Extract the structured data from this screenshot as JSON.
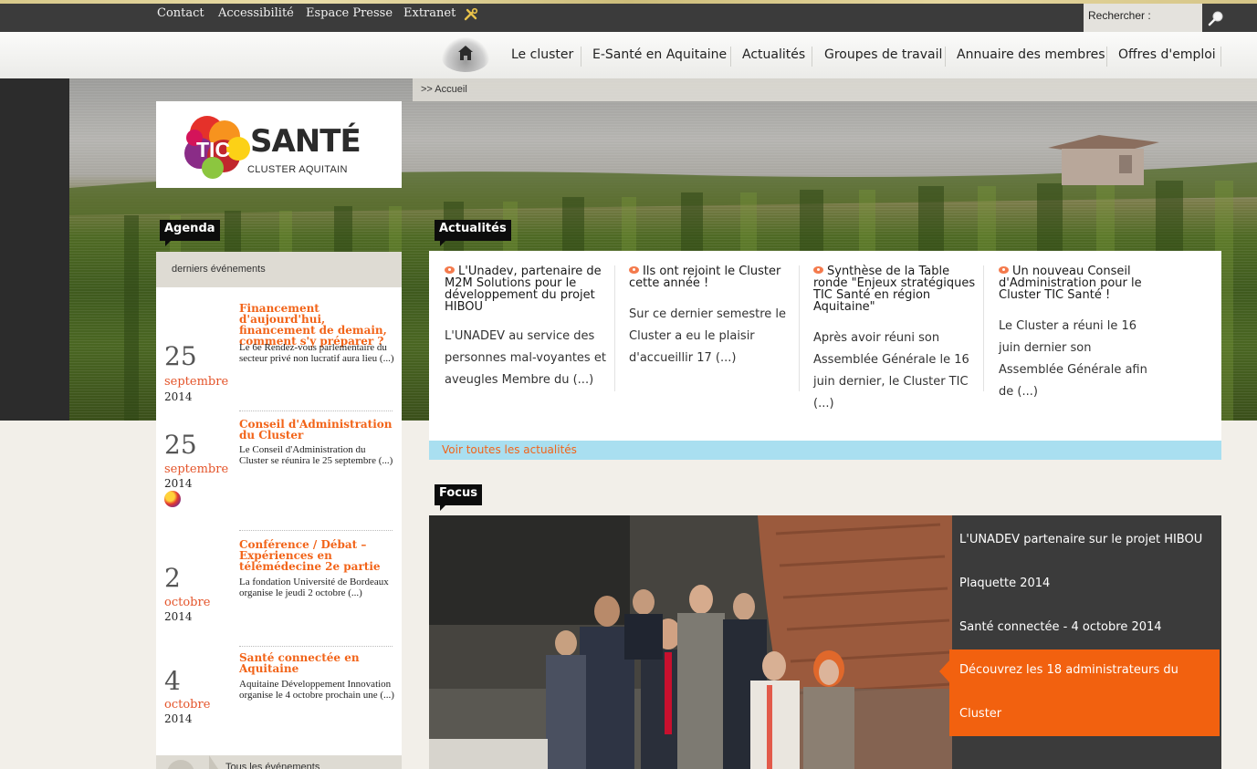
{
  "topbar": {
    "links": [
      "Contact",
      "Accessibilité",
      "Espace Presse",
      "Extranet"
    ],
    "search_label": "Rechercher :",
    "search_value": ""
  },
  "nav": {
    "items": [
      "Le cluster",
      "E-Santé en Aquitaine",
      "Actualités",
      "Groupes de travail",
      "Annuaire des membres",
      "Offres d'emploi"
    ]
  },
  "breadcrumb": ">> Accueil",
  "logo": {
    "mark": "TIC",
    "name": "SANTÉ",
    "subtitle": "CLUSTER AQUITAIN"
  },
  "agenda": {
    "tag": "Agenda",
    "header": "derniers événements",
    "events": [
      {
        "day": "25",
        "month": "septembre",
        "year": "2014",
        "title": "Financement d'aujourd'hui, financement de demain, comment s'y préparer ?",
        "desc": "Le 6e Rendez-vous parlementaire du secteur privé non lucratif aura lieu (...)"
      },
      {
        "day": "25",
        "month": "septembre",
        "year": "2014",
        "title": "Conseil d'Administration du Cluster",
        "desc": "Le Conseil d'Administration du Cluster se réunira le 25 septembre (...)"
      },
      {
        "day": "2",
        "month": "octobre",
        "year": "2014",
        "title": "Conférence / Débat – Expériences en télémédecine 2e partie",
        "desc": "La fondation Université de Bordeaux organise le jeudi 2 octobre (...)"
      },
      {
        "day": "4",
        "month": "octobre",
        "year": "2014",
        "title": "Santé connectée en Aquitaine",
        "desc": "Aquitaine Développement Innovation organise le 4 octobre prochain une (...)"
      }
    ],
    "all_events": "Tous les événements"
  },
  "news": {
    "tag": "Actualités",
    "items": [
      {
        "title": "L'Unadev, partenaire de M2M Solutions pour le développement du projet HIBOU",
        "body": "L'UNADEV au service des personnes mal-voyantes et aveugles Membre du (...)"
      },
      {
        "title": "Ils ont rejoint le Cluster cette année !",
        "body": "Sur ce dernier semestre le Cluster a eu le plaisir d'accueillir 17 (...)"
      },
      {
        "title": "Synthèse de la Table ronde \"Enjeux stratégiques TIC Santé en région Aquitaine\"",
        "body": "Après avoir réuni son Assemblée Générale le 16 juin dernier, le Cluster TIC (...)"
      },
      {
        "title": "Un nouveau Conseil d'Administration pour le Cluster TIC Santé !",
        "body": "Le Cluster a réuni le 16 juin dernier son Assemblée Générale afin de (...)"
      }
    ],
    "more": "Voir toutes les actualités"
  },
  "focus": {
    "tag": "Focus",
    "items": [
      "L'UNADEV partenaire sur le projet HIBOU",
      "Plaquette 2014",
      "Santé connectée - 4 octobre 2014"
    ],
    "active": [
      "Découvrez les 18 administrateurs du",
      "Cluster"
    ]
  },
  "colors": {
    "accent": "#f26419",
    "topbar": "#3b3b3b",
    "news_more_bg": "#a9dff0",
    "date_month": "#e4542a"
  }
}
